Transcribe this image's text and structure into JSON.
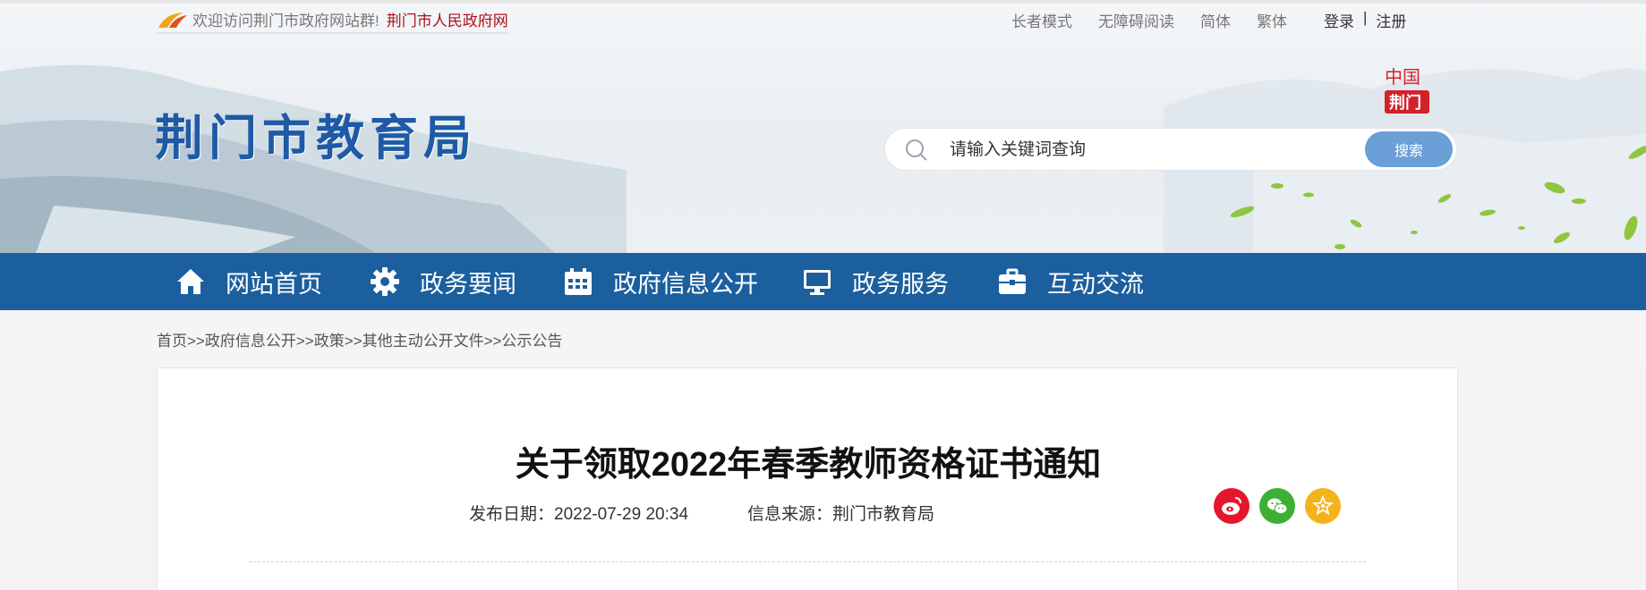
{
  "topbar": {
    "welcome_text": "欢迎访问荆门市政府网站群!",
    "welcome_link": "荆门市人民政府网",
    "links": [
      "长者模式",
      "无障碍阅读",
      "简体",
      "繁体"
    ],
    "login": "登录",
    "separator": "|",
    "register": "注册"
  },
  "header": {
    "site_title": "荆门市教育局",
    "seal_text_top": "中国",
    "seal_text_bottom": "荆门"
  },
  "search": {
    "placeholder": "请输入关键词查询",
    "button_label": "搜索"
  },
  "nav": {
    "items": [
      {
        "label": "网站首页",
        "icon": "home-icon"
      },
      {
        "label": "政务要闻",
        "icon": "gear-icon"
      },
      {
        "label": "政府信息公开",
        "icon": "calendar-icon"
      },
      {
        "label": "政务服务",
        "icon": "monitor-icon"
      },
      {
        "label": "互动交流",
        "icon": "briefcase-icon"
      }
    ]
  },
  "breadcrumb": {
    "text": "首页>>政府信息公开>>政策>>其他主动公开文件>>公示公告"
  },
  "article": {
    "title": "关于领取2022年春季教师资格证书通知",
    "date_label": "发布日期：2022-07-29 20:34",
    "source_label": "信息来源：荆门市教育局",
    "share_icons": [
      "weibo-icon",
      "wechat-icon",
      "favorite-star-icon"
    ]
  },
  "colors": {
    "nav_bg": "#1c5f9e",
    "title_blue": "#1e5aa6",
    "link_red": "#b0121b",
    "search_button": "#6a9fd8",
    "weibo": "#e6162d",
    "wechat": "#3cb034",
    "favorite": "#f5b21b"
  }
}
